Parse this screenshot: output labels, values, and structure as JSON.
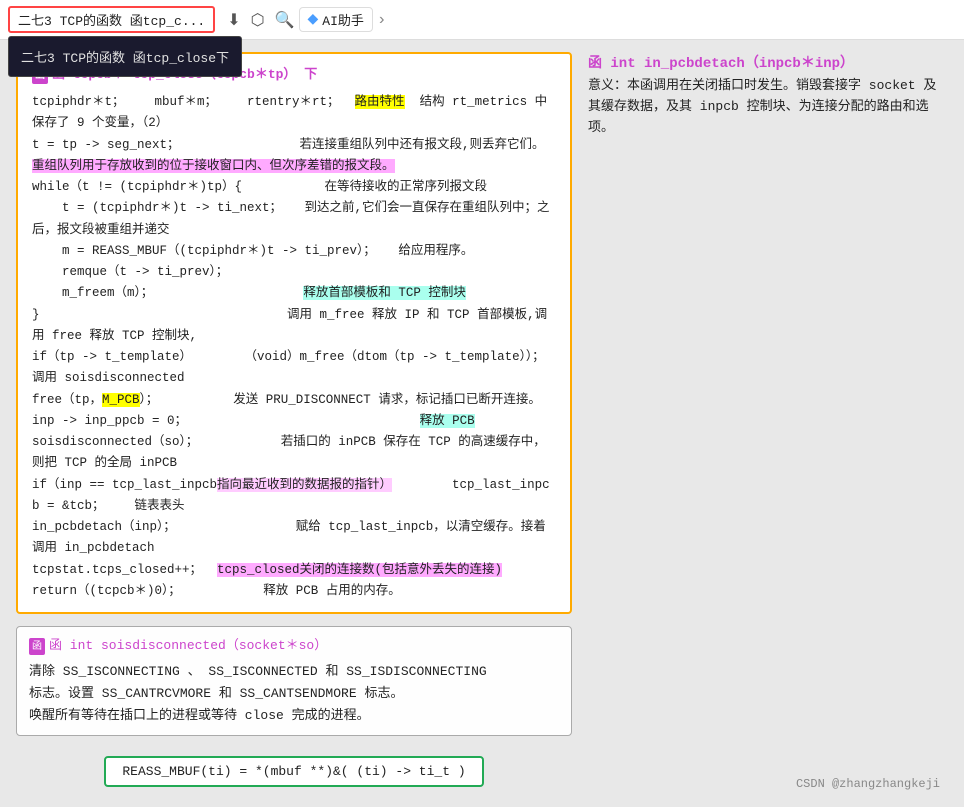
{
  "topbar": {
    "breadcrumb": "二七3 TCP的函数 函tcp_c...",
    "dropdown_item": "二七3 TCP的函数 函tcp_close下",
    "icons": [
      "download",
      "tag",
      "search"
    ],
    "ai_button": "AI助手",
    "arrow": "›"
  },
  "right_panel": {
    "func_header": "函  int  in_pcbdetach（inpcb＊inp）",
    "desc": "意义：本函调用在关闭插口时发生。销毁套接字 socket 及其缓存数据，及其 inpcb 控制块、为连接分配的路由和选项。"
  },
  "main_code_block": {
    "header": "函  tcpcb＊  tcp_close（tcpcb＊tp）    下",
    "lines": [
      {
        "text": "tcpiphdr＊t；    mbuf＊m；    rtentry＊rt；"
      },
      {
        "highlight": "路由特性",
        "hl_class": "hl-yellow",
        "suffix": "  结构 rt_metrics 中保存了 9 个变量，（2）"
      },
      {
        "text": "t = tp -> seg_next；"
      },
      {
        "suffix2": "若连接重组队列中还有报文段,则丢弃它们。",
        "hl2": "重组队列用于存放收到的位于接收窗口内、但次序差错的报文段。",
        "hl2_class": "hl-pink"
      },
      {
        "text": "while（t != (tcpiphdr＊)tp）{"
      },
      {
        "suffix3": "   在等待接收的正常序列报文段"
      },
      {
        "text": "    t = (tcpiphdr＊)t -> ti_next；   到达之前,它们会一直保存在重组队列中；之后，报文段被重组并递交"
      },
      {
        "text": "    m = REASS_MBUF（(tcpiphdr＊)t -> ti_prev）；   给应用程序。"
      },
      {
        "text": "    remque（t -> ti_prev）；"
      },
      {
        "text": "    m_freem（m）；"
      },
      {
        "hl_block": "释放首部模板和 TCP 控制块",
        "hl_class": "hl-cyan"
      },
      {
        "text": "}"
      },
      {
        "suffix4": "调用 m_free 释放 IP 和 TCP 首部模板,调用 free 释放 TCP 控制块,"
      },
      {
        "text": "if（tp -> t_template）       （void）m_free（dtom（tp -> t_template））；  调用 soisdisconnected"
      },
      {
        "text": "free（tp，"
      },
      {
        "hl_mid": "M_PCB",
        "hl_class": "hl-yellow",
        "suffix5": "）；          发送 PRU_DISCONNECT 请求，标记插口已断开连接。"
      },
      {
        "text": "inp -> inp_ppcb = 0；"
      },
      {
        "hl_block2": "释放 PCB",
        "hl_class": "hl-cyan",
        "pos": "right"
      },
      {
        "text": "soisdisconnected（so）；           若插口的 inPCB 保存在 TCP 的高速缓存中，则把 TCP 的全局 inPCB"
      },
      {
        "text": "if（inp == tcp_last_inpcb"
      },
      {
        "hl_inline": "指向最近收到的数据报的指针）",
        "hl_class": "hl-light-pink",
        "suffix6": "    tcp_last_inpcb = &tcb；    链表表头"
      },
      {
        "text": "in_pcbdetach（inp）；                赋给 tcp_last_inpcb，以清空缓存。接着调用 in_pcbdetach"
      },
      {
        "text": "tcpstat.tcps_closed++；"
      },
      {
        "hl_stat": "tcps_closed关闭的连接数(包括意外丢失的连接)",
        "hl_class": "hl-pink"
      },
      {
        "text": "return（(tcpcb＊)0）；           释放 PCB 占用的内存。"
      }
    ]
  },
  "info_block": {
    "header": "函   int  soisdisconnected（socket＊so）",
    "lines": [
      "清除 SS_ISCONNECTING 、 SS_ISCONNECTED 和 SS_ISDISCONNECTING",
      "标志。设置 SS_CANTRCVMORE 和 SS_CANTSENDMORE 标志。",
      "唤醒所有等待在插口上的进程或等待 close 完成的进程。"
    ]
  },
  "formula": "REASS_MBUF(ti)  =   *(mbuf **)&(  (ti) -> ti_t   )",
  "watermark": "CSDN @zhangzhangkeji"
}
